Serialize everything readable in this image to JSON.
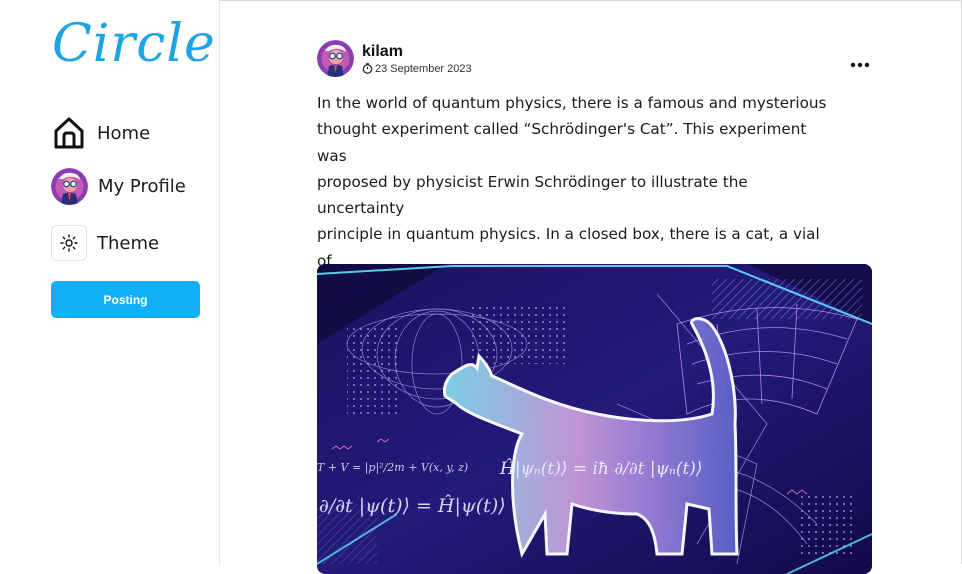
{
  "app": {
    "logo_text": "Circle"
  },
  "sidebar": {
    "items": [
      {
        "label": "Home",
        "icon": "home-icon"
      },
      {
        "label": "My Profile",
        "icon": "avatar"
      },
      {
        "label": "Theme",
        "icon": "sun-icon"
      }
    ],
    "posting_label": "Posting"
  },
  "post": {
    "username": "kilam",
    "date": "23 September 2023",
    "more_icon": "more-horizontal-icon",
    "text": "In the world of quantum physics, there is a famous and mysterious\nthought experiment called “Schrödinger's Cat”. This experiment was\nproposed by physicist Erwin Schrödinger to illustrate the uncertainty\nprinciple in quantum physics.  In a closed box, there is a cat, a vial of\npoison, and a mechanism connected to quantum events, such as the\ndecay of atomic nuclei.",
    "image": {
      "equation_main": "Ĥ|ψn(t)⟩ = iħ ∂/∂t |ψn(t)⟩",
      "equation_left": "∂/∂t |ψ(t)⟩ = Ĥ|ψ(t)⟩",
      "equation_top": "T + V = |p|²/2m + V(x, y, z)"
    }
  },
  "colors": {
    "accent": "#10b0f7",
    "logo": "#1ea4e6"
  }
}
